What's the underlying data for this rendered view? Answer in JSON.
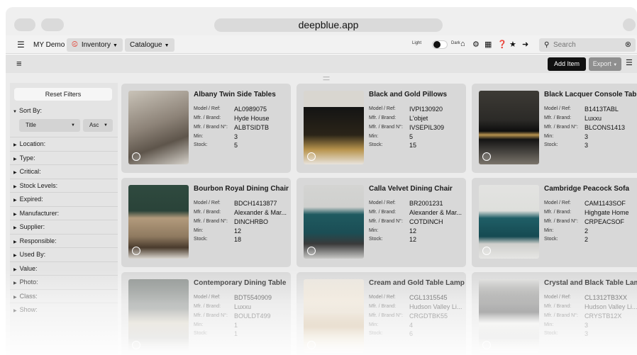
{
  "browser": {
    "url": "deepblue.app"
  },
  "nav": {
    "app_icon": "bed-icon",
    "items": [
      {
        "label": "MY Demo",
        "dropdown": false
      },
      {
        "label": "Inventory",
        "icon": "box-icon",
        "dropdown": true
      },
      {
        "label": "Catalogue",
        "dropdown": true
      }
    ],
    "theme_light": "Light",
    "theme_dark": "Dark",
    "icons": [
      "home-icon",
      "gear-icon",
      "qr-icon",
      "help-icon",
      "star-icon",
      "logout-icon"
    ],
    "search_placeholder": "Search"
  },
  "toolbar": {
    "add_label": "Add Item",
    "export_label": "Export"
  },
  "sidebar": {
    "reset_label": "Reset Filters",
    "sort_label": "Sort By:",
    "sort_field": "Title",
    "sort_order": "Asc",
    "filters": [
      "Location:",
      "Type:",
      "Critical:",
      "Stock Levels:",
      "Expired:",
      "Manufacturer:",
      "Supplier:",
      "Responsible:",
      "Used By:",
      "Value:",
      "Photo:",
      "Class:",
      "Show:"
    ]
  },
  "field_labels": {
    "ref": "Model / Ref:",
    "brand": "Mfr. / Brand:",
    "brand_no": "Mfr. / Brand N°:",
    "min": "Min:",
    "stock": "Stock:"
  },
  "items": [
    {
      "title": "Albany Twin Side Tables",
      "ref": "AL0989075",
      "brand": "Hyde House",
      "brand_no": "ALBTSIDTB",
      "min": "3",
      "stock": "5"
    },
    {
      "title": "Black and Gold Pillows",
      "ref": "IVPI130920",
      "brand": "L'objet",
      "brand_no": "IVSEPIL309",
      "min": "5",
      "stock": "15"
    },
    {
      "title": "Black Lacquer Console Table",
      "ref": "B1413TABL",
      "brand": "Luxxu",
      "brand_no": "BLCONS1413",
      "min": "3",
      "stock": "3"
    },
    {
      "title": "Bourbon Royal Dining Chair",
      "ref": "BDCH1413877",
      "brand": "Alexander & Mar...",
      "brand_no": "DINCHRBO",
      "min": "12",
      "stock": "18"
    },
    {
      "title": "Calla Velvet Dining Chair",
      "ref": "BR2001231",
      "brand": "Alexander & Mar...",
      "brand_no": "COTDINCH",
      "min": "12",
      "stock": "12"
    },
    {
      "title": "Cambridge Peacock Sofa",
      "ref": "CAM1143SOF",
      "brand": "Highgate Home",
      "brand_no": "CRPEACSOF",
      "min": "2",
      "stock": "2"
    },
    {
      "title": "Contemporary Dining Table",
      "ref": "BDT5540909",
      "brand": "Luxxu",
      "brand_no": "BOULDT499",
      "min": "1",
      "stock": "1"
    },
    {
      "title": "Cream and Gold Table Lamp",
      "ref": "CGL1315545",
      "brand": "Hudson Valley Li...",
      "brand_no": "CRGDTBK55",
      "min": "4",
      "stock": "6"
    },
    {
      "title": "Crystal and Black Table Lamps",
      "ref": "CL1312TB3XX",
      "brand": "Hudson Valley Li...",
      "brand_no": "CRYSTB12X",
      "min": "3",
      "stock": "3"
    }
  ]
}
